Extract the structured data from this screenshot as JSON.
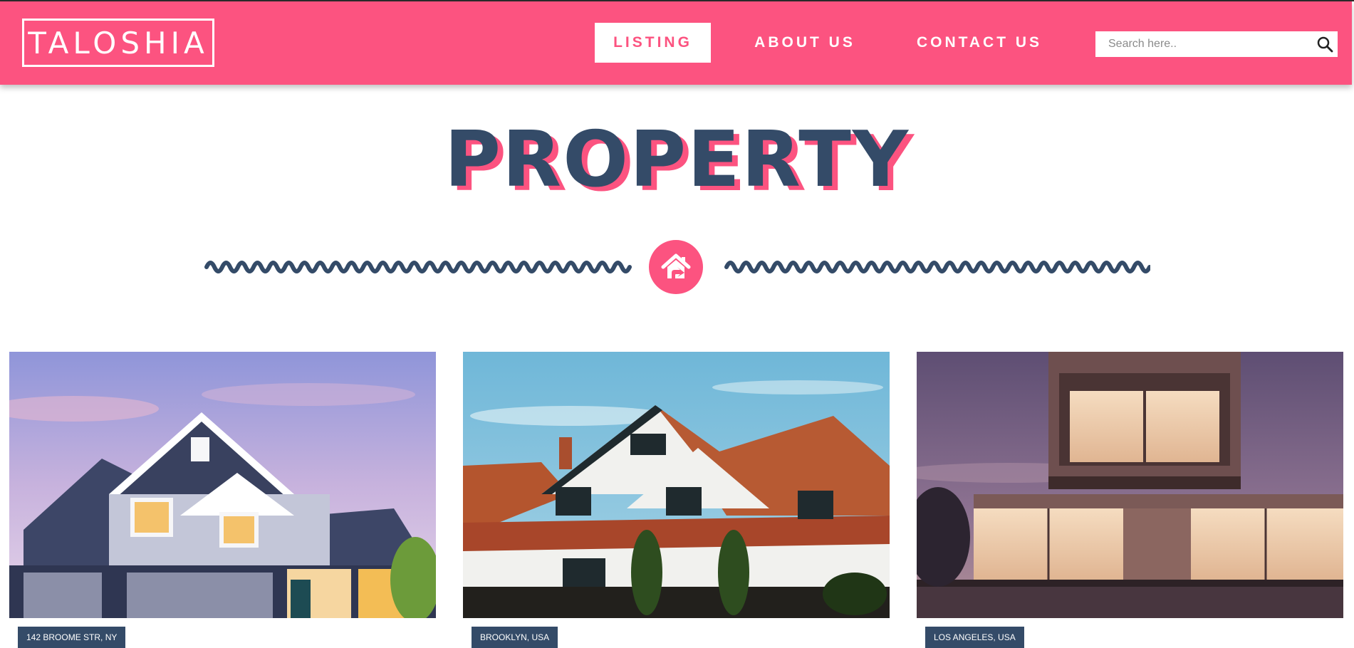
{
  "brand": {
    "logo": "TALOSHIA"
  },
  "nav": {
    "items": [
      {
        "label": "LISTING",
        "active": true
      },
      {
        "label": "ABOUT US",
        "active": false
      },
      {
        "label": "CONTACT US",
        "active": false
      }
    ]
  },
  "search": {
    "placeholder": "Search here..",
    "value": "",
    "icon": "search-icon"
  },
  "hero": {
    "title": "PROPERTY",
    "icon": "house-icon"
  },
  "listings": [
    {
      "location": "142 BROOME STR, NY",
      "image": "blue suburban house at dusk"
    },
    {
      "location": "BROOKLYN, USA",
      "image": "tudor style house with red tile roof"
    },
    {
      "location": "LOS ANGELES, USA",
      "image": "modern illuminated villa at dusk"
    }
  ],
  "colors": {
    "accent": "#fc5380",
    "navy": "#344b68",
    "white": "#ffffff"
  }
}
